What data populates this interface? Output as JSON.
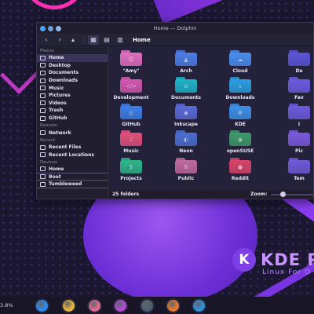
{
  "window": {
    "title": "Home — Dolphin"
  },
  "toolbar": {
    "breadcrumb": "Home"
  },
  "sidebar": {
    "sections": [
      {
        "title": "Places",
        "items": [
          "Home",
          "Desktop",
          "Documents",
          "Downloads",
          "Music",
          "Pictures",
          "Videos",
          "Trash",
          "GitHub"
        ]
      },
      {
        "title": "Remote",
        "items": [
          "Network"
        ]
      },
      {
        "title": "Recent",
        "items": [
          "Recent Files",
          "Recent Locations"
        ]
      },
      {
        "title": "Devices",
        "items": [
          "Home",
          "Boot",
          "Tumbleweed"
        ]
      }
    ],
    "active_item": "Home"
  },
  "folders": [
    {
      "label": "\"Amy\"",
      "color": "#e26fbf",
      "glyph": "☺"
    },
    {
      "label": "Arch",
      "color": "#4c7ee6",
      "glyph": "▲"
    },
    {
      "label": "Cloud",
      "color": "#4a8ef0",
      "glyph": "☁"
    },
    {
      "label": "De",
      "color": "#5b55d8",
      "glyph": ""
    },
    {
      "label": "Development",
      "color": "#d457b0",
      "glyph": "</>"
    },
    {
      "label": "Documents",
      "color": "#1fb3c8",
      "glyph": "≡"
    },
    {
      "label": "Downloads",
      "color": "#2a9fe0",
      "glyph": "↓"
    },
    {
      "label": "Fav",
      "color": "#6a5ae0",
      "glyph": ""
    },
    {
      "label": "GitHub",
      "color": "#3d7fe6",
      "glyph": "◎"
    },
    {
      "label": "Inkscape",
      "color": "#5a6ad6",
      "glyph": "◆"
    },
    {
      "label": "KDE",
      "color": "#3d8fe8",
      "glyph": "✻"
    },
    {
      "label": "I",
      "color": "#6c5adc",
      "glyph": ""
    },
    {
      "label": "Music",
      "color": "#e2507c",
      "glyph": "♪"
    },
    {
      "label": "Neon",
      "color": "#4b6ed0",
      "glyph": "◐"
    },
    {
      "label": "openSUSE",
      "color": "#3e9a6a",
      "glyph": "◉"
    },
    {
      "label": "Pic",
      "color": "#7a5adc",
      "glyph": ""
    },
    {
      "label": "Projects",
      "color": "#2db58a",
      "glyph": "$"
    },
    {
      "label": "Public",
      "color": "#c06a9e",
      "glyph": "⇅"
    },
    {
      "label": "Reddit",
      "color": "#d8456a",
      "glyph": "●"
    },
    {
      "label": "Tem",
      "color": "#6f5ad8",
      "glyph": ""
    }
  ],
  "status": {
    "folder_count": "25 folders",
    "zoom_label": "Zoom:",
    "zoom_level": 0.25
  },
  "panel": {
    "left_text": "3.8%"
  },
  "taskbar": [
    {
      "name": "app-launcher",
      "color": "#2a8cf0"
    },
    {
      "name": "app-2",
      "color": "#e8b63c"
    },
    {
      "name": "app-3",
      "color": "#e06a8a"
    },
    {
      "name": "app-4",
      "color": "#b24ad8"
    },
    {
      "name": "app-5",
      "color": "#4a6070"
    },
    {
      "name": "app-6",
      "color": "#e87a2a"
    },
    {
      "name": "app-7",
      "color": "#2a90d8"
    }
  ]
}
